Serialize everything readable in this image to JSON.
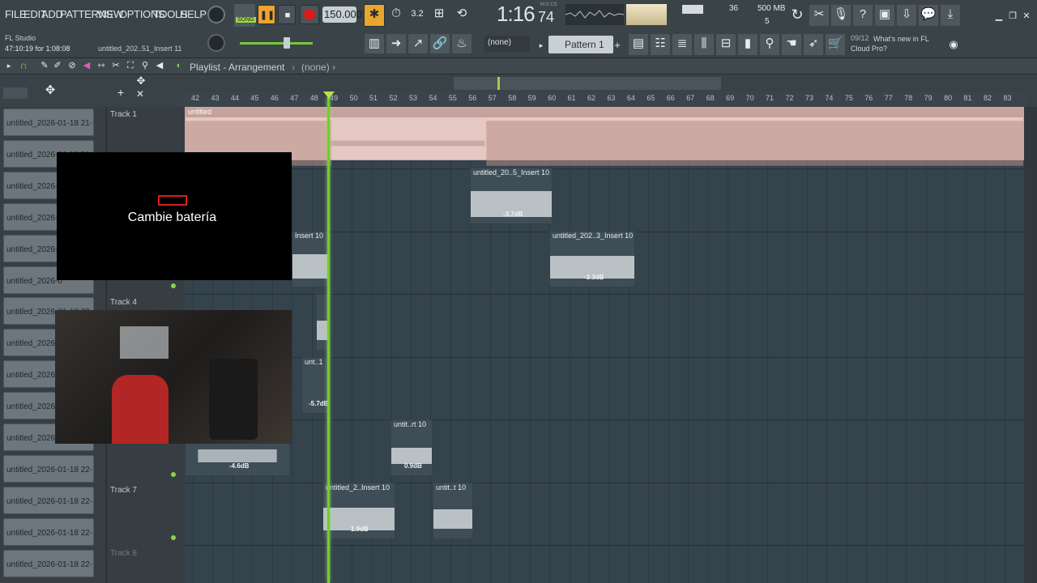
{
  "menu": [
    "FILE",
    "EDIT",
    "ADD",
    "PATTERNS",
    "VIEW",
    "OPTIONS",
    "TOOLS",
    "HELP"
  ],
  "transport": {
    "song_label": "SONG",
    "tempo": "150.000",
    "time": "1:16",
    "time_ticks": "74",
    "time_unit": "M:S:CS",
    "pattern": "Pattern 1",
    "channel": "(none)"
  },
  "meters": {
    "cpu": "36",
    "ram": "500 MB",
    "voices": "5"
  },
  "app": {
    "name": "FL Studio",
    "elapsed": "47:10:19 for 1:08:08",
    "project": "untitled_202..51_Insert 11"
  },
  "news": {
    "date": "09/12",
    "text": "What's new in FL Cloud Pro?"
  },
  "playlist": {
    "title": "Playlist - Arrangement",
    "crumb": "(none)"
  },
  "ruler": [
    "42",
    "43",
    "44",
    "45",
    "46",
    "47",
    "48",
    "49",
    "50",
    "51",
    "52",
    "53",
    "54",
    "55",
    "56",
    "57",
    "58",
    "59",
    "60",
    "61",
    "62",
    "63",
    "64",
    "65",
    "66",
    "67",
    "68",
    "69",
    "70",
    "71",
    "72",
    "73",
    "74",
    "75",
    "76",
    "77",
    "78",
    "79",
    "80",
    "81",
    "82",
    "83"
  ],
  "track_names": [
    "untitled_2026-01-18 21-...",
    "untitled_2026-01-18 21-...",
    "untitled_2026-0",
    "untitled_2026-0",
    "untitled_2026-0",
    "untitled_2026-0",
    "untitled_2026-01-18 22-...",
    "untitled_2026-0",
    "untitled_2026-0",
    "untitled_2026-0",
    "untitled_2026-0",
    "untitled_2026-01-18 22-...",
    "untitled_2026-01-18 22-...",
    "untitled_2026-01-18 22-...",
    "untitled_2026-01-18 22-..."
  ],
  "track_headers": [
    "Track 1",
    "Track 4",
    "Track 7",
    "Track 8"
  ],
  "clips": {
    "top": "untitled",
    "c1": "untitled_20..5_Insert 10",
    "c1_db": "-3.7dB",
    "c2": "untitled_202..3_Insert 10",
    "c2_db": "-3.3dB",
    "c3": "Insert 10",
    "c4": "unt..1",
    "c4_db": "-5.7dB",
    "c5": "untit..rt 10",
    "c5_db": "0.9dB",
    "c6": "untitled_2..Insert 10",
    "c6_db": "1.9dB",
    "c7": "untit..t 10",
    "c8_db": "-4.6dB"
  },
  "overlay": {
    "text": "Cambie batería"
  },
  "colors": {
    "accent": "#76c83a",
    "clip": "#e6c9c4",
    "record": "#d81c1c"
  }
}
